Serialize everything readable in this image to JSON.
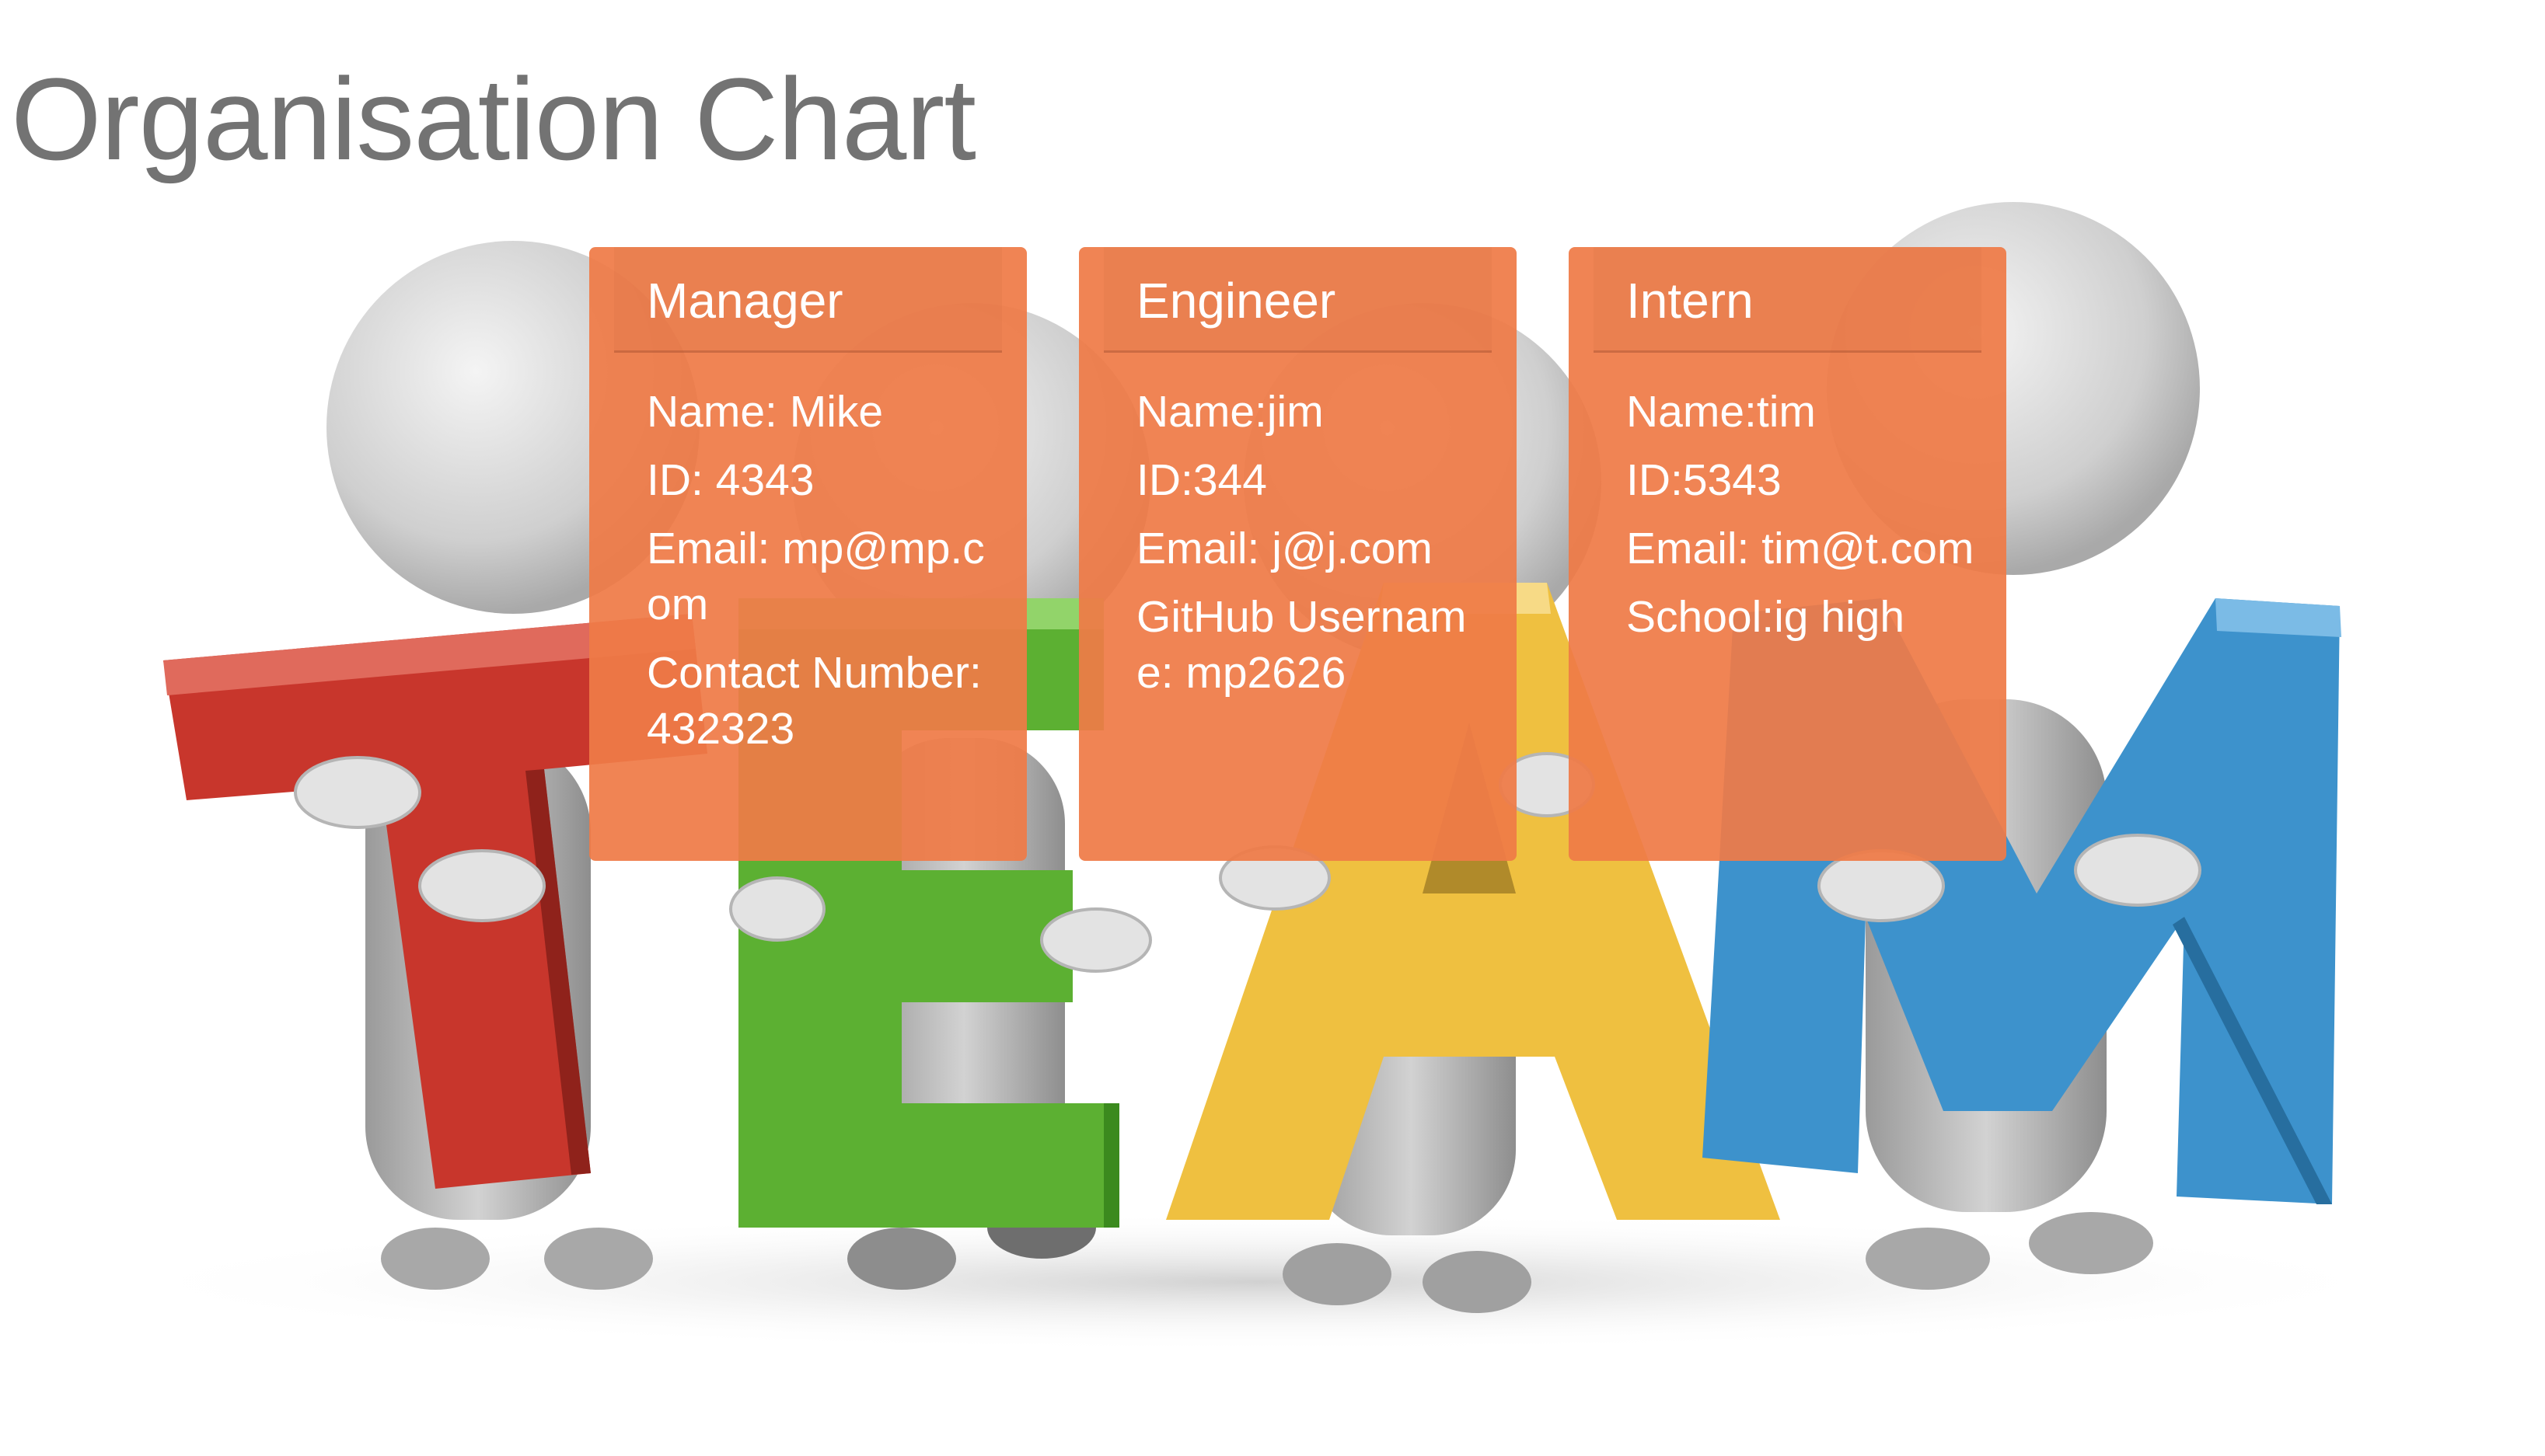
{
  "page": {
    "title": "Organisation Chart"
  },
  "hero_image": {
    "letters": [
      "T",
      "E",
      "A",
      "M"
    ],
    "letter_colors": [
      "#c8362c",
      "#5cb032",
      "#efc040",
      "#3d92cc"
    ]
  },
  "cards": [
    {
      "role": "Manager",
      "fields": [
        "Name: Mike",
        "ID: 4343",
        "Email: mp@mp.com",
        "Contact Number:432323"
      ]
    },
    {
      "role": "Engineer",
      "fields": [
        "Name:jim",
        "ID:344",
        "Email: j@j.com",
        "GitHub Username: mp2626"
      ]
    },
    {
      "role": "Intern",
      "fields": [
        "Name:tim",
        "ID:5343",
        "Email: tim@t.com",
        "School:ig high"
      ]
    }
  ],
  "colors": {
    "card_background": "#ef7b47",
    "title_text": "#737373"
  }
}
